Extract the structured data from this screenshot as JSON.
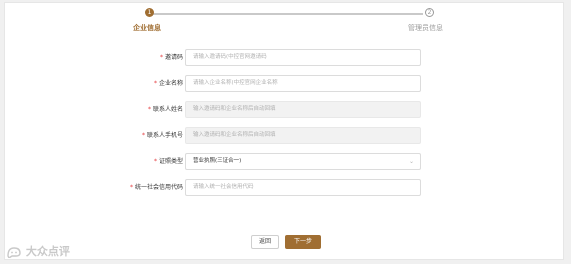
{
  "steps": [
    {
      "number": "1",
      "label": "企业信息"
    },
    {
      "number": "2",
      "label": "管理员信息"
    }
  ],
  "progress": 0,
  "form": {
    "invite_code": {
      "label": "邀请码",
      "required": "*",
      "placeholder": "请输入邀请码(中控官网邀请码"
    },
    "company_name": {
      "label": "企业名称",
      "required": "*",
      "placeholder": "请输入企业名称(中控官网企业名称"
    },
    "contact_name": {
      "label": "联系人姓名",
      "required": "*",
      "placeholder": "输入邀请码和企业名称后自动回填"
    },
    "contact_phone": {
      "label": "联系人手机号",
      "required": "*",
      "placeholder": "输入邀请码和企业名称后自动回填"
    },
    "cert_type": {
      "label": "证照类型",
      "required": "*",
      "value": "营业执照(三证合一)"
    },
    "credit_code": {
      "label": "统一社会信用代码",
      "required": "*",
      "placeholder": "请输入统一社会信用代码"
    }
  },
  "buttons": {
    "back": "返回",
    "next": "下一步"
  },
  "watermark": {
    "text": "大众点评"
  },
  "colors": {
    "accent": "#a06e32",
    "required": "#e4393c"
  }
}
